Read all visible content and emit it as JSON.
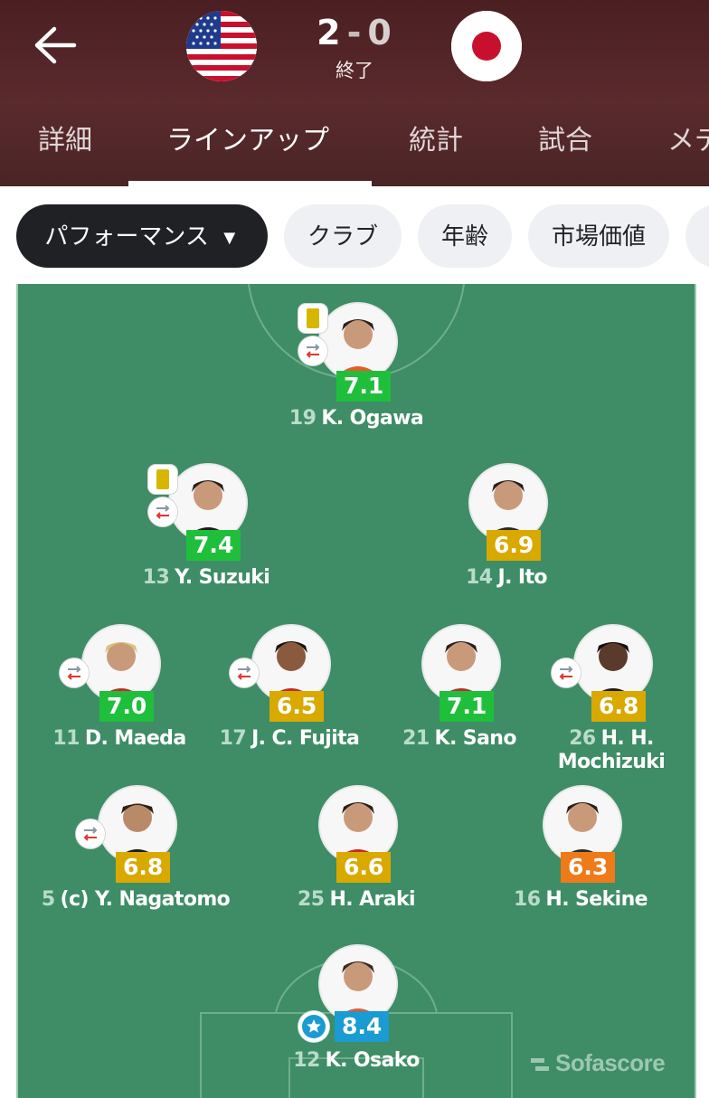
{
  "header": {
    "back_icon": "arrow-left-icon",
    "home_team_flag": "usa-flag",
    "away_team_flag": "japan-flag",
    "home_score": "2",
    "score_separator": "-",
    "away_score": "0",
    "status": "終了",
    "colors": {
      "background": "#4b1f22",
      "text": "#ffffff"
    }
  },
  "tabs": [
    {
      "label": "詳細",
      "active": false
    },
    {
      "label": "ラインアップ",
      "active": true
    },
    {
      "label": "統計",
      "active": false
    },
    {
      "label": "試合",
      "active": false
    },
    {
      "label": "メデ",
      "active": false
    }
  ],
  "chips": [
    {
      "label": "パフォーマンス",
      "icon": "caret-down-icon",
      "active": true
    },
    {
      "label": "クラブ",
      "active": false
    },
    {
      "label": "年齢",
      "active": false
    },
    {
      "label": "市場価値",
      "active": false
    }
  ],
  "rating_colors": {
    "green": "#1fbf3c",
    "yellow": "#d9a900",
    "orange": "#ef7a1a",
    "blue": "#1a9bd1"
  },
  "players": [
    {
      "number": "19",
      "name": "K. Ogawa",
      "rating": "7.1",
      "rating_color": "#1fbf3c",
      "badges": [
        "yellow-card-icon",
        "substitution-icon"
      ]
    },
    {
      "number": "13",
      "name": "Y. Suzuki",
      "rating": "7.4",
      "rating_color": "#1fbf3c",
      "badges": [
        "yellow-card-icon",
        "substitution-icon"
      ]
    },
    {
      "number": "14",
      "name": "J. Ito",
      "rating": "6.9",
      "rating_color": "#d9a900",
      "badges": []
    },
    {
      "number": "11",
      "name": "D. Maeda",
      "rating": "7.0",
      "rating_color": "#1fbf3c",
      "badges": [
        "substitution-icon"
      ]
    },
    {
      "number": "17",
      "name": "J. C. Fujita",
      "rating": "6.5",
      "rating_color": "#d9a900",
      "badges": [
        "substitution-icon"
      ]
    },
    {
      "number": "21",
      "name": "K. Sano",
      "rating": "7.1",
      "rating_color": "#1fbf3c",
      "badges": []
    },
    {
      "number": "26",
      "name_line1": "H. H.",
      "name_line2": "Mochizuki",
      "rating": "6.8",
      "rating_color": "#d9a900",
      "badges": [
        "substitution-icon"
      ]
    },
    {
      "number": "5",
      "name": "(c) Y. Nagatomo",
      "rating": "6.8",
      "rating_color": "#d9a900",
      "badges": [
        "substitution-icon"
      ]
    },
    {
      "number": "25",
      "name": "H. Araki",
      "rating": "6.6",
      "rating_color": "#d9a900",
      "badges": []
    },
    {
      "number": "16",
      "name": "H. Sekine",
      "rating": "6.3",
      "rating_color": "#ef7a1a",
      "badges": []
    },
    {
      "number": "12",
      "name": "K. Osako",
      "rating": "8.4",
      "rating_color": "#1a9bd1",
      "badges": [
        "star-icon"
      ]
    }
  ],
  "watermark": {
    "text": "Sofascore",
    "icon": "sofascore-logo-icon"
  }
}
